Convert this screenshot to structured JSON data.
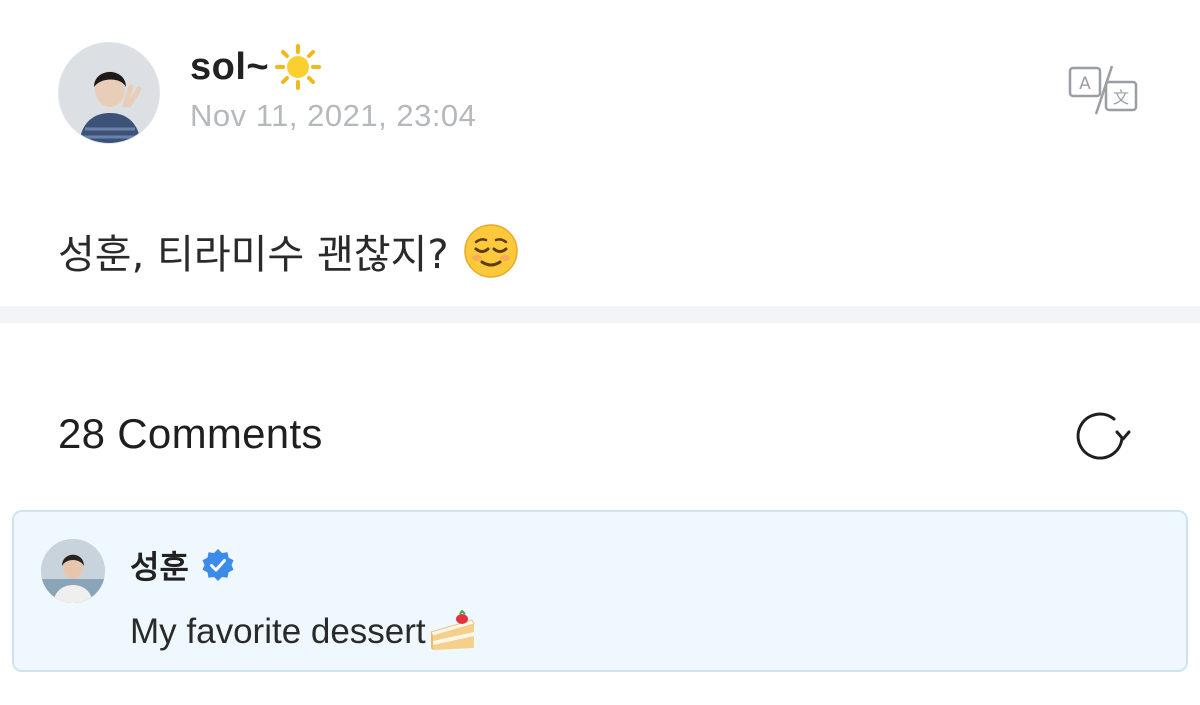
{
  "post": {
    "author_name": "sol~",
    "date": "Nov 11, 2021, 23:04",
    "body_text": "성훈, 티라미수 괜찮지?",
    "icons": {
      "author_suffix": "sun-icon",
      "body_emoji": "relieved-face-icon",
      "translate": "translate-icon"
    }
  },
  "comments": {
    "title": "28 Comments",
    "refresh_icon": "refresh-icon",
    "items": [
      {
        "author": "성훈",
        "verified": true,
        "text": "My favorite dessert",
        "emoji": "shortcake-icon"
      }
    ]
  },
  "colors": {
    "date_gray": "#b5b8bd",
    "divider": "#f2f4f8",
    "comment_bg": "#eef8fe",
    "comment_border": "#cfe3ef",
    "verified_blue": "#3d8be8"
  }
}
